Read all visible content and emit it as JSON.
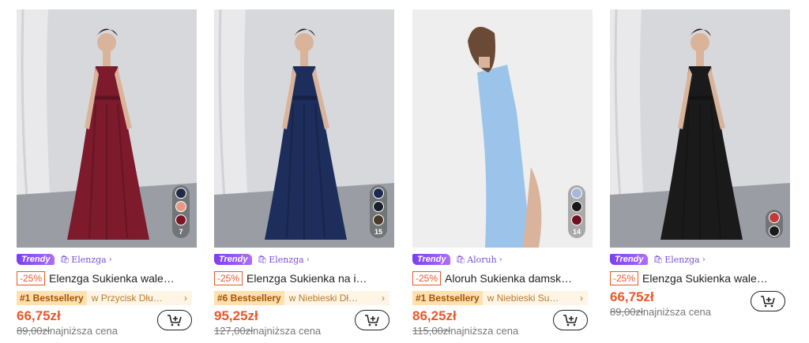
{
  "products": [
    {
      "badge": "Trendy",
      "store": "Elenzga",
      "discount": "-25%",
      "title": "Elenzga Sukienka wale…",
      "bestseller_rank": "#1 Bestsellery",
      "bestseller_category": "w Przycisk Dłu…",
      "price": "66,75zł",
      "old_price": "89,00zł",
      "lowest_label": "najniższa cena",
      "swatch_count": "7",
      "dress_color": "#7d1a2c",
      "swatches": [
        "#1f2a44",
        "#e59a86",
        "#7a1626"
      ]
    },
    {
      "badge": "Trendy",
      "store": "Elenzga",
      "discount": "-25%",
      "title": "Elenzga Sukienka na i…",
      "bestseller_rank": "#6 Bestsellery",
      "bestseller_category": "w Niebieski Dł…",
      "price": "95,25zł",
      "old_price": "127,00zł",
      "lowest_label": "najniższa cena",
      "swatch_count": "15",
      "dress_color": "#1d2d5c",
      "swatches": [
        "#1c2a52",
        "#1a1f2e",
        "#4a3a2c"
      ]
    },
    {
      "badge": "Trendy",
      "store": "Aloruh",
      "discount": "-25%",
      "title": "Aloruh Sukienka damsk…",
      "bestseller_rank": "#1 Bestsellery",
      "bestseller_category": "w Niebieski Su…",
      "price": "86,25zł",
      "old_price": "115,00zł",
      "lowest_label": "najniższa cena",
      "swatch_count": "14",
      "dress_color": "#9cc4ea",
      "swatches": [
        "#a8b8dc",
        "#1a1a1a",
        "#6e1020"
      ]
    },
    {
      "badge": "Trendy",
      "store": "Elenzga",
      "discount": "-25%",
      "title": "Elenzga Sukienka wale…",
      "price": "66,75zł",
      "old_price": "89,00zł",
      "lowest_label": "najniższa cena",
      "dress_color": "#1a1a1a",
      "swatches": [
        "#c23a3a",
        "#1a1a1a"
      ]
    }
  ],
  "icons": {
    "store": "bag-icon",
    "cart": "add-to-cart-icon",
    "chevron": "chevron-right-icon"
  }
}
